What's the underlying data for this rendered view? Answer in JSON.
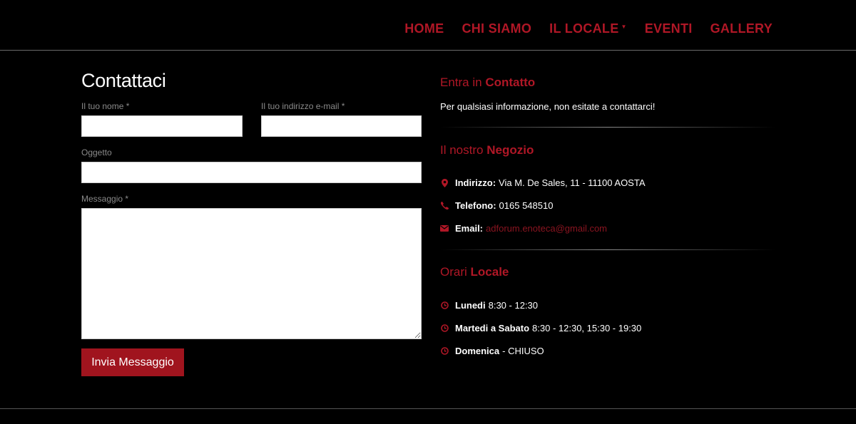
{
  "nav": {
    "items": [
      "HOME",
      "CHI SIAMO",
      "IL LOCALE",
      "EVENTI",
      "GALLERY"
    ]
  },
  "form": {
    "title": "Contattaci",
    "name_label": "Il tuo nome *",
    "name_value": "",
    "email_label": "Il tuo indirizzo e-mail *",
    "email_value": "",
    "subject_label": "Oggetto",
    "subject_value": "",
    "message_label": "Messaggio *",
    "message_value": "",
    "submit_label": "Invia Messaggio"
  },
  "contact": {
    "heading_light": "Entra in",
    "heading_bold": "Contatto",
    "intro": "Per qualsiasi informazione, non esitate a contattarci!"
  },
  "shop": {
    "heading_light": "Il nostro",
    "heading_bold": "Negozio",
    "address_label": "Indirizzo:",
    "address_value": "Via M. De Sales, 11 - 11100 AOSTA",
    "phone_label": "Telefono:",
    "phone_value": "0165 548510",
    "email_label": "Email:",
    "email_value": "adforum.enoteca@gmail.com"
  },
  "hours": {
    "heading_light": "Orari",
    "heading_bold": "Locale",
    "rows": [
      {
        "day": "Lunedi",
        "time": "8:30 - 12:30"
      },
      {
        "day": "Martedi a Sabato",
        "time": "8:30 - 12:30, 15:30 - 19:30"
      },
      {
        "day": "Domenica",
        "time": "- CHIUSO"
      }
    ]
  },
  "icons": {
    "address": "map-marker-icon",
    "phone": "phone-icon",
    "email": "envelope-icon",
    "clock": "clock-icon",
    "dropdown": "caret-down-icon"
  },
  "colors": {
    "accent": "#b01726",
    "button": "#a0141e",
    "background": "#000000"
  }
}
